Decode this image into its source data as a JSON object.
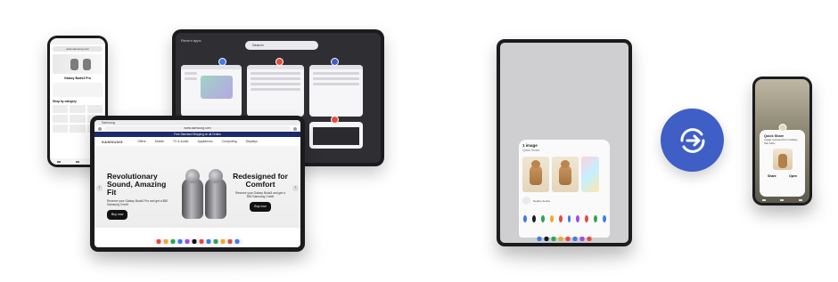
{
  "phone_left": {
    "url": "www.samsung.com",
    "hero_text": "Galaxy Buds3 Pro",
    "section_heading": "Shop by category"
  },
  "tablet_top": {
    "label": "Recent apps",
    "search_placeholder": "Search",
    "dock_icons": [
      "G",
      "G"
    ]
  },
  "tablet_big": {
    "tab_title": "Samsung",
    "url": "www.samsung.com",
    "banner": "Free Standard Shipping on all Orders",
    "logo": "SAMSUNG",
    "nav_items": [
      "Offers",
      "Mobile",
      "TV & Audio",
      "Appliances",
      "Computing",
      "Displays"
    ],
    "hero_left_title": "Revolutionary Sound, Amazing Fit",
    "hero_left_sub": "Reserve your Galaxy Buds3 Pro and get a $50 Samsung Credit",
    "hero_right_title": "Redesigned for Comfort",
    "hero_right_sub": "Reserve your Galaxy Buds3 and get a $50 Samsung Credit",
    "buy_label": "Buy now",
    "dock_colors": [
      "#e84a3c",
      "#f4a72a",
      "#2aa655",
      "#3f7be8",
      "#9c4ce6",
      "#111111",
      "#e84a3c",
      "#3f7be8",
      "#2aa655",
      "#f4a72a",
      "#e84a3c",
      "#3f7be8"
    ]
  },
  "tablet_right": {
    "title": "1 image",
    "subtitle": "Quick Share",
    "share_label": "Nearby device",
    "share_colors": [
      "#3f7be8",
      "#1b1b1e",
      "#2aa655",
      "#f4a72a",
      "#e84a3c",
      "#3f7be8",
      "#9c4ce6",
      "#e84a3c",
      "#2aa655",
      "#3f7be8"
    ]
  },
  "quick_share_icon": {
    "name": "quick-share-icon",
    "color": "#3f5ec6"
  },
  "phone_right": {
    "title": "Quick Share",
    "description": "Image received from Galaxy Tab S10+",
    "action_left": "Share",
    "action_right": "Open"
  }
}
